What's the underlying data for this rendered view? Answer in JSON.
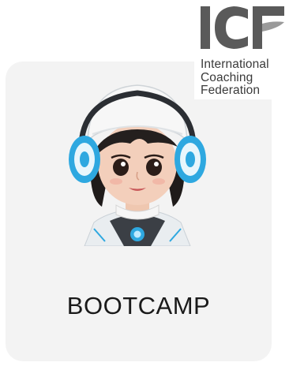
{
  "card": {
    "label": "BOOTCAMP"
  },
  "logo": {
    "mark_text": "ICF",
    "lines": [
      "International",
      "Coaching",
      "Federation"
    ],
    "colors": {
      "mark_dark": "#5a5a5a",
      "mark_light": "#9a9a9a"
    }
  },
  "avatar": {
    "icon": "robot-coach-avatar-icon",
    "accent_color": "#2ea8e0"
  }
}
